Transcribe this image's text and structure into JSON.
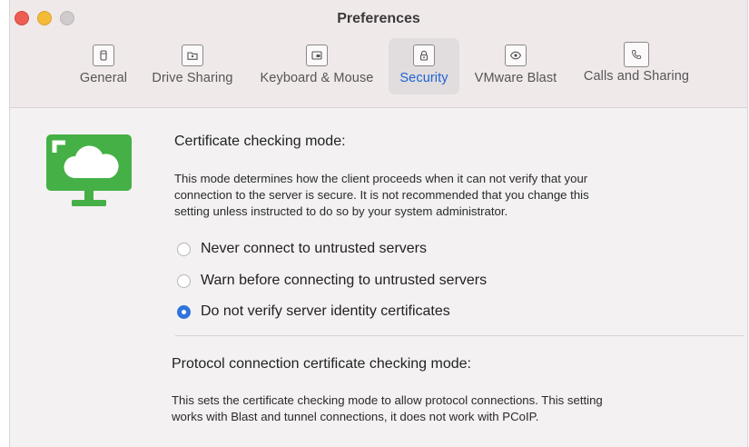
{
  "window": {
    "title": "Preferences"
  },
  "tabs": [
    {
      "label": "General",
      "icon": "general-icon"
    },
    {
      "label": "Drive Sharing",
      "icon": "folder-icon"
    },
    {
      "label": "Keyboard & Mouse",
      "icon": "keyboard-icon"
    },
    {
      "label": "Security",
      "icon": "lock-icon"
    },
    {
      "label": "VMware Blast",
      "icon": "eye-icon"
    },
    {
      "label": "Calls and Sharing",
      "icon": "phone-icon"
    }
  ],
  "active_tab": "Security",
  "colors": {
    "accent": "#2f74dd",
    "illustration": "#45b046"
  },
  "security": {
    "cert_heading": "Certificate checking mode:",
    "cert_desc": [
      "This mode determines how the client proceeds when it can not verify that your",
      "connection to the server is secure. It is not recommended that you change this",
      "setting unless instructed to do so by your system administrator."
    ],
    "options": [
      {
        "label": "Never connect to untrusted servers",
        "checked": false
      },
      {
        "label": "Warn before connecting to untrusted servers",
        "checked": false
      },
      {
        "label": "Do not verify server identity certificates",
        "checked": true
      }
    ],
    "protocol_heading": "Protocol connection certificate checking mode:",
    "protocol_desc": [
      "This sets the certificate checking mode to allow protocol connections. This setting",
      "works with Blast and tunnel connections, it does not work with PCoIP."
    ]
  }
}
